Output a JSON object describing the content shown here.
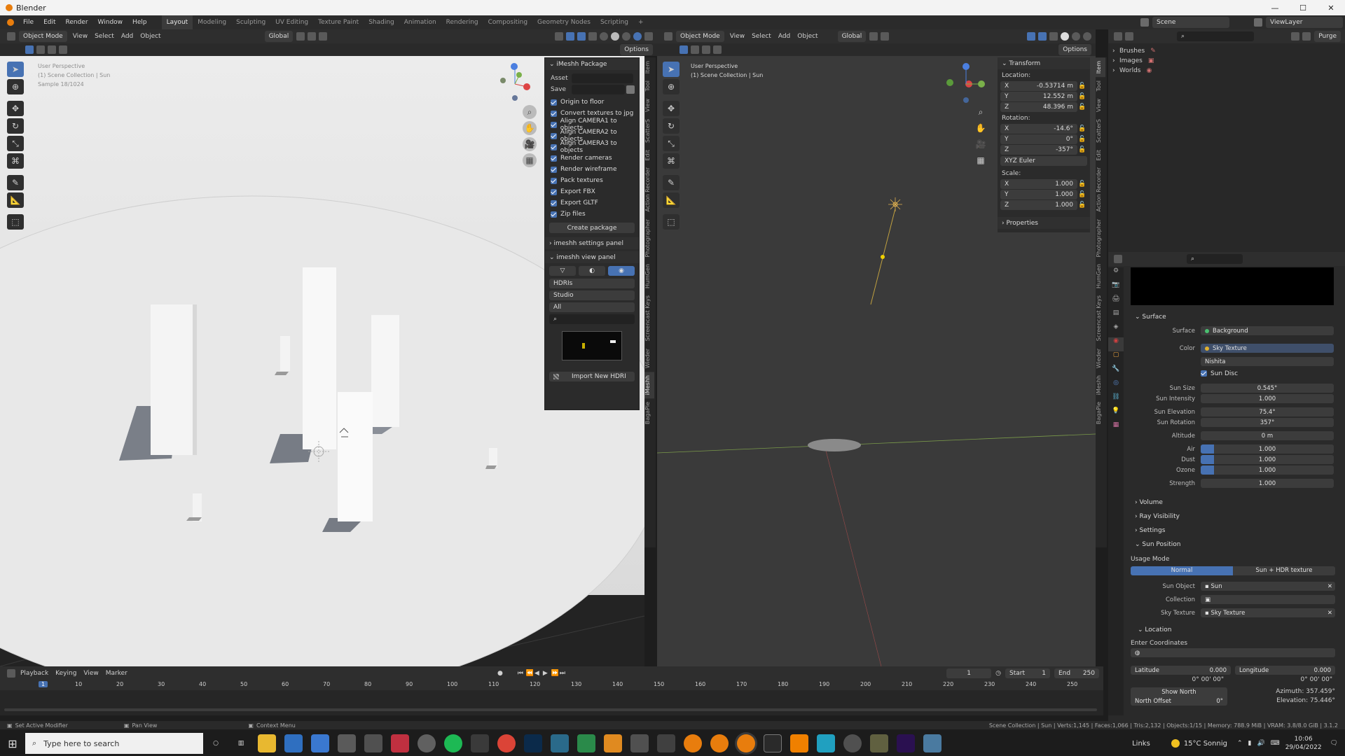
{
  "titlebar": {
    "app": "Blender"
  },
  "menus": [
    "File",
    "Edit",
    "Render",
    "Window",
    "Help"
  ],
  "workspaces": [
    "Layout",
    "Modeling",
    "Sculpting",
    "UV Editing",
    "Texture Paint",
    "Shading",
    "Animation",
    "Rendering",
    "Compositing",
    "Geometry Nodes",
    "Scripting",
    "+"
  ],
  "left_viewport": {
    "header": {
      "mode": "Object Mode",
      "view": "View",
      "select": "Select",
      "add": "Add",
      "object": "Object",
      "orientation": "Global",
      "options": "Options"
    },
    "overlay_text": [
      "User Perspective",
      "(1) Scene Collection | Sun",
      "Sample 18/1024"
    ]
  },
  "imeshh": {
    "package_title": "iMeshh Package",
    "asset_label": "Asset",
    "save_label": "Save",
    "checkboxes": [
      "Origin to floor",
      "Convert textures to jpg",
      "Align CAMERA1 to objects",
      "Align CAMERA2 to objects",
      "Align CAMERA3 to objects",
      "Render cameras",
      "Render wireframe",
      "Pack textures",
      "Export FBX",
      "Export GLTF",
      "Zip files"
    ],
    "create_button": "Create package",
    "settings_panel": "imeshh settings panel",
    "view_panel": "imeshh view panel",
    "dd1": "HDRIs",
    "dd2": "Studio",
    "dd3": "All",
    "import_button": "Import New HDRI"
  },
  "left_vtabs": [
    "Item",
    "Tool",
    "View",
    "ScatterS",
    "Edit",
    "Action Recorder",
    "Photographer",
    "HumGen",
    "Screencast Keys",
    "Wieder",
    "iMeshh",
    "BagaPie"
  ],
  "right_viewport": {
    "header": {
      "mode": "Object Mode",
      "view": "View",
      "select": "Select",
      "add": "Add",
      "object": "Object",
      "orientation": "Global",
      "options": "Options"
    },
    "overlay_text": [
      "User Perspective",
      "(1) Scene Collection | Sun"
    ]
  },
  "transform": {
    "title": "Transform",
    "location_label": "Location:",
    "location": [
      {
        "axis": "X",
        "value": "-0.53714 m"
      },
      {
        "axis": "Y",
        "value": "12.552 m"
      },
      {
        "axis": "Z",
        "value": "48.396 m"
      }
    ],
    "rotation_label": "Rotation:",
    "rotation": [
      {
        "axis": "X",
        "value": "-14.6°"
      },
      {
        "axis": "Y",
        "value": "0°"
      },
      {
        "axis": "Z",
        "value": "-357°"
      }
    ],
    "rotation_mode": "XYZ Euler",
    "scale_label": "Scale:",
    "scale": [
      {
        "axis": "X",
        "value": "1.000"
      },
      {
        "axis": "Y",
        "value": "1.000"
      },
      {
        "axis": "Z",
        "value": "1.000"
      }
    ],
    "properties": "Properties"
  },
  "outliner": {
    "search": "Scene",
    "view_layer": "ViewLayer",
    "purge": "Purge",
    "items": [
      "Brushes",
      "Images",
      "Worlds"
    ]
  },
  "properties": {
    "surface_header": "Surface",
    "surface_label": "Surface",
    "surface_value": "Background",
    "color_label": "Color",
    "color_value": "Sky Texture",
    "sky_type": "Nishita",
    "sun_disc": "Sun Disc",
    "rows": [
      {
        "label": "Sun Size",
        "value": "0.545°"
      },
      {
        "label": "Sun Intensity",
        "value": "1.000"
      },
      {
        "label": "Sun Elevation",
        "value": "75.4°"
      },
      {
        "label": "Sun Rotation",
        "value": "357°"
      },
      {
        "label": "Altitude",
        "value": "0 m"
      },
      {
        "label": "Air",
        "value": "1.000"
      },
      {
        "label": "Dust",
        "value": "1.000"
      },
      {
        "label": "Ozone",
        "value": "1.000"
      },
      {
        "label": "Strength",
        "value": "1.000"
      }
    ],
    "collapsed": [
      "Volume",
      "Ray Visibility",
      "Settings"
    ],
    "sun_position": "Sun Position",
    "usage_mode": "Usage Mode",
    "mode_normal": "Normal",
    "mode_hdr": "Sun + HDR texture",
    "sun_object_label": "Sun Object",
    "sun_object": "Sun",
    "collection_label": "Collection",
    "sky_texture_label": "Sky Texture",
    "sky_texture": "Sky Texture",
    "location": "Location",
    "enter_coords": "Enter Coordinates",
    "latitude_label": "Latitude",
    "latitude": "0.000",
    "longitude_label": "Longitude",
    "longitude": "0.000",
    "lat_dms": "0° 00' 00\"",
    "lon_dms": "0° 00' 00\"",
    "show_north": "Show North",
    "north_offset_label": "North Offset",
    "north_offset": "0°",
    "azimuth": "Azimuth: 357.459°",
    "elevation": "Elevation: 75.446°"
  },
  "right_vtabs": [
    "Item",
    "Tool",
    "View",
    "ScatterS",
    "Edit",
    "Action Recorder",
    "Photographer",
    "HumGen",
    "Screencast Keys",
    "Wieder",
    "iMeshh",
    "BagaPie"
  ],
  "timeline": {
    "menus": [
      "Playback",
      "Keying",
      "View",
      "Marker"
    ],
    "current_frame": "1",
    "start_label": "Start",
    "start": "1",
    "end_label": "End",
    "end": "250",
    "ticks": [
      "1",
      "10",
      "20",
      "30",
      "40",
      "50",
      "60",
      "70",
      "80",
      "90",
      "100",
      "110",
      "120",
      "130",
      "140",
      "150",
      "160",
      "170",
      "180",
      "190",
      "200",
      "210",
      "220",
      "230",
      "240",
      "250"
    ]
  },
  "statusbar": {
    "left": "Set Active Modifier",
    "middle": "Pan View",
    "context": "Context Menu",
    "right": "Scene Collection | Sun | Verts:1,145 | Faces:1,066 | Tris:2,132 | Objects:1/15 | Memory: 788.9 MiB | VRAM: 3.8/8.0 GiB | 3.1.2"
  },
  "taskbar": {
    "search_placeholder": "Type here to search",
    "links": "Links",
    "weather": "15°C Sonnig",
    "time": "10:06",
    "date": "29/04/2022"
  }
}
